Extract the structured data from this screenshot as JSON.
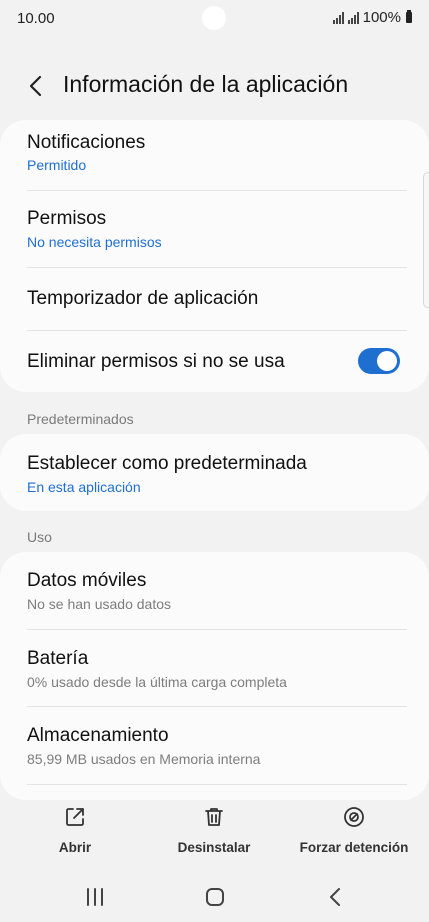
{
  "status_bar": {
    "time": "10.00",
    "battery": "100%"
  },
  "header": {
    "title": "Información de la aplicación"
  },
  "card1": {
    "rows": [
      {
        "title": "Notificaciones",
        "subtitle": "Permitido"
      },
      {
        "title": "Permisos",
        "subtitle": "No necesita permisos"
      },
      {
        "title": "Temporizador de aplicación"
      },
      {
        "title": "Eliminar permisos si no se usa",
        "toggle_on": true
      }
    ]
  },
  "section_defaults": {
    "label": "Predeterminados"
  },
  "card2": {
    "rows": [
      {
        "title": "Establecer como predeterminada",
        "subtitle": "En esta aplicación"
      }
    ]
  },
  "section_usage": {
    "label": "Uso"
  },
  "card3": {
    "rows": [
      {
        "title": "Datos móviles",
        "subtitle": "No se han usado datos"
      },
      {
        "title": "Batería",
        "subtitle": "0% usado desde la última carga completa"
      },
      {
        "title": "Almacenamiento",
        "subtitle": "85,99 MB usados en Memoria interna"
      }
    ]
  },
  "actions": [
    {
      "label": "Abrir",
      "icon": "open-external-icon"
    },
    {
      "label": "Desinstalar",
      "icon": "trash-icon"
    },
    {
      "label": "Forzar detención",
      "icon": "stop-circle-icon"
    }
  ],
  "nav": [
    "recent-apps-icon",
    "home-icon",
    "back-icon"
  ],
  "colors": {
    "accent": "#1f6fd1",
    "background": "#f2f2f2",
    "card": "#fbfbfb"
  }
}
